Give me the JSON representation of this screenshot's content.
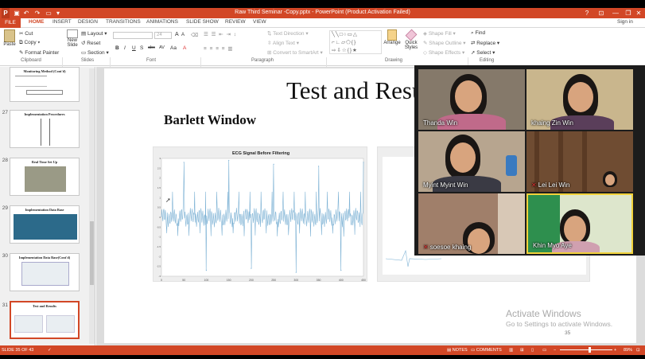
{
  "window": {
    "title": "Raw Third Seminar -Copy.pptx - PowerPoint (Product Activation Failed)",
    "min": "—",
    "max": "❐",
    "close": "✕",
    "help": "?",
    "sign_in": "Sign in"
  },
  "tabs": [
    "FILE",
    "HOME",
    "INSERT",
    "DESIGN",
    "TRANSITIONS",
    "ANIMATIONS",
    "SLIDE SHOW",
    "REVIEW",
    "VIEW"
  ],
  "ribbon": {
    "clipboard": {
      "paste": "Paste",
      "cut": "Cut",
      "copy": "Copy",
      "format_painter": "Format Painter",
      "group": "Clipboard"
    },
    "slides": {
      "new_slide": "New Slide",
      "layout": "Layout",
      "reset": "Reset",
      "section": "Section",
      "group": "Slides"
    },
    "font": {
      "size": "24",
      "group": "Font",
      "bold": "B",
      "italic": "I",
      "underline": "U",
      "shadow": "S",
      "strike": "abc",
      "spacing": "AV",
      "case": "Aa",
      "grow": "A",
      "shrink": "A"
    },
    "paragraph": {
      "text_direction": "Text Direction",
      "align_text": "Align Text",
      "smartart": "Convert to SmartArt",
      "group": "Paragraph"
    },
    "drawing": {
      "arrange": "Arrange",
      "quick_styles": "Quick Styles",
      "shape_fill": "Shape Fill",
      "shape_outline": "Shape Outline",
      "shape_effects": "Shape Effects",
      "group": "Drawing"
    },
    "editing": {
      "find": "Find",
      "replace": "Replace",
      "select": "Select",
      "group": "Editing"
    }
  },
  "thumbnails": [
    {
      "num": "",
      "title": "Monitoring Method (Cont'd)"
    },
    {
      "num": "27",
      "title": "Implementation Procedures"
    },
    {
      "num": "28",
      "title": "Real Time Set Up"
    },
    {
      "num": "29",
      "title": "Implementation Data Base"
    },
    {
      "num": "30",
      "title": "Implementation Data Base(Cont'd)"
    },
    {
      "num": "31",
      "title": "Test and Results"
    }
  ],
  "slide": {
    "title": "Test and Results",
    "subtitle": "Barlett Window",
    "chart_title": "ECG Signal Before Filtering",
    "page_number": "35"
  },
  "chart_data": {
    "type": "line",
    "title": "ECG Signal Before Filtering",
    "x": [
      0,
      50,
      100,
      150,
      200,
      250,
      300,
      350,
      400,
      450
    ],
    "ylim": [
      -3,
      3
    ],
    "xlabel": "",
    "ylabel": "",
    "x_tick_labels": [
      "0",
      "50",
      "100",
      "150",
      "200",
      "250",
      "300",
      "350",
      "400",
      "450"
    ],
    "y_tick_labels": [
      "3",
      "2.5",
      "2",
      "1.5",
      "1",
      "0.5",
      "0",
      "-0.5",
      "-1",
      "-1.5",
      "-2",
      "-2.5",
      "-3"
    ],
    "series": [
      {
        "values": [
          0.1,
          2.8,
          -2.7,
          2.9,
          -2.6,
          2.7,
          -2.8,
          2.6,
          -2.7,
          2.8
        ]
      }
    ],
    "grid": false
  },
  "watermark": {
    "line1": "Activate Windows",
    "line2": "Go to Settings to activate Windows."
  },
  "status": {
    "slide": "SLIDE 35 OF 43",
    "notes": "NOTES",
    "comments": "COMMENTS",
    "zoom": "89%"
  },
  "participants": [
    {
      "name": "Thanda Win",
      "muted": false,
      "bg": "#8a7a68"
    },
    {
      "name": "khaing Zin Win",
      "muted": false,
      "bg": "#c9b68d"
    },
    {
      "name": "Myint Myint Win",
      "muted": false,
      "bg": "#b7a58f"
    },
    {
      "name": "Lei Lei Win",
      "muted": true,
      "bg": "#6f4c32"
    },
    {
      "name": "soesoe khaing",
      "muted": true,
      "bg": "#a07f6a"
    },
    {
      "name": "Khin Myo Aye",
      "muted": false,
      "bg": "#2e8f4e"
    }
  ],
  "colors": {
    "accent": "#d24726",
    "active_speaker": "#f2d23a"
  }
}
